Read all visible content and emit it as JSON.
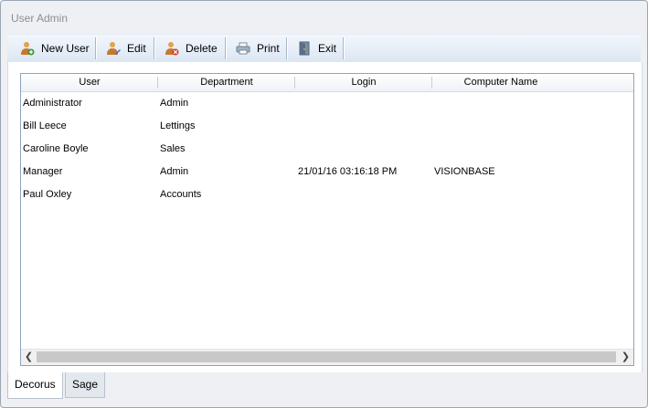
{
  "window": {
    "title": "User Admin"
  },
  "toolbar": {
    "buttons": [
      {
        "label": "New User",
        "icon": "user-add-icon"
      },
      {
        "label": "Edit",
        "icon": "user-edit-icon"
      },
      {
        "label": "Delete",
        "icon": "user-delete-icon"
      },
      {
        "label": "Print",
        "icon": "printer-icon"
      },
      {
        "label": "Exit",
        "icon": "exit-door-icon"
      }
    ]
  },
  "grid": {
    "columns": [
      "User",
      "Department",
      "Login",
      "Computer Name"
    ],
    "rows": [
      {
        "user": "Administrator",
        "department": "Admin",
        "login": "",
        "computer": ""
      },
      {
        "user": "Bill Leece",
        "department": "Lettings",
        "login": "",
        "computer": ""
      },
      {
        "user": "Caroline Boyle",
        "department": "Sales",
        "login": "",
        "computer": ""
      },
      {
        "user": "Manager",
        "department": "Admin",
        "login": "21/01/16 03:16:18 PM",
        "computer": "VISIONBASE"
      },
      {
        "user": "Paul Oxley",
        "department": "Accounts",
        "login": "",
        "computer": ""
      }
    ]
  },
  "tabs": [
    {
      "label": "Decorus",
      "active": true
    },
    {
      "label": "Sage",
      "active": false
    }
  ],
  "colors": {
    "toolbar_bg": "#dbe6f3",
    "grid_border": "#8fa4bd",
    "window_bg": "#eef0f3"
  }
}
